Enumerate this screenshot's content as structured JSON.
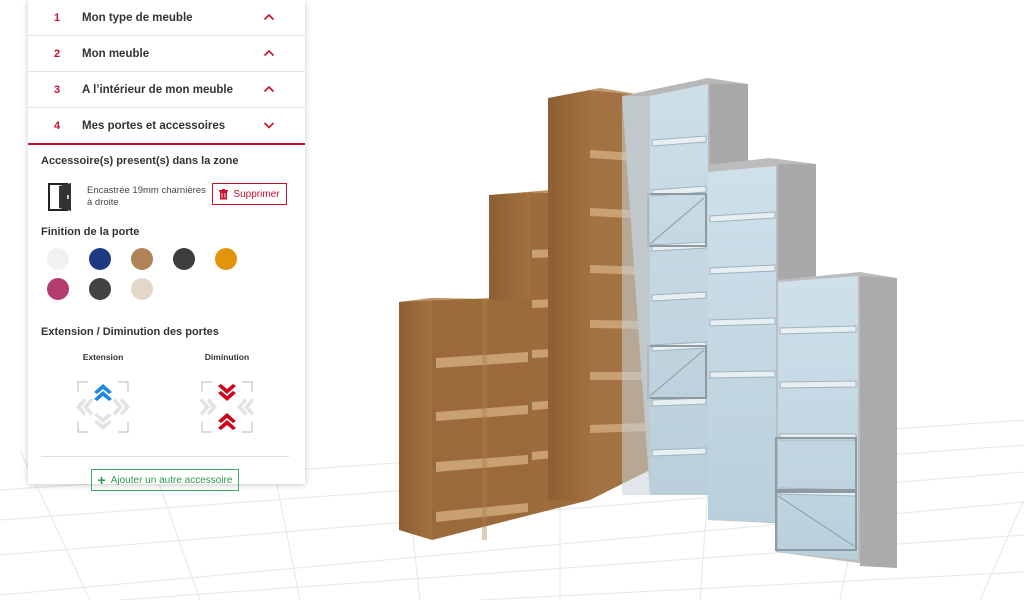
{
  "steps": [
    {
      "num": "1",
      "label": "Mon type de meuble",
      "state": "collapsed"
    },
    {
      "num": "2",
      "label": "Mon meuble",
      "state": "collapsed"
    },
    {
      "num": "3",
      "label": "A l’intérieur de mon meuble",
      "state": "collapsed"
    },
    {
      "num": "4",
      "label": "Mes portes et accessoires",
      "state": "expanded"
    }
  ],
  "accessories": {
    "title": "Accessoire(s) present(s) dans la zone",
    "item_line1": "Encastrée 19mm charnières",
    "item_line2": "à droite",
    "delete_label": "Supprimer"
  },
  "finish": {
    "title": "Finition de la porte",
    "swatches": [
      "#f1f1f1",
      "#1d3a83",
      "#b08257",
      "#3d3d3d",
      "#e2950c",
      "#b33b6e",
      "#434240",
      "#e4d6c8"
    ]
  },
  "extension": {
    "title": "Extension / Diminution des portes",
    "extension_label": "Extension",
    "diminution_label": "Diminution"
  },
  "add_accessory_label": "Ajouter un autre accessoire",
  "colors": {
    "accent": "#c8102e",
    "success": "#3cab5d",
    "extension_blue": "#1e88e5"
  }
}
